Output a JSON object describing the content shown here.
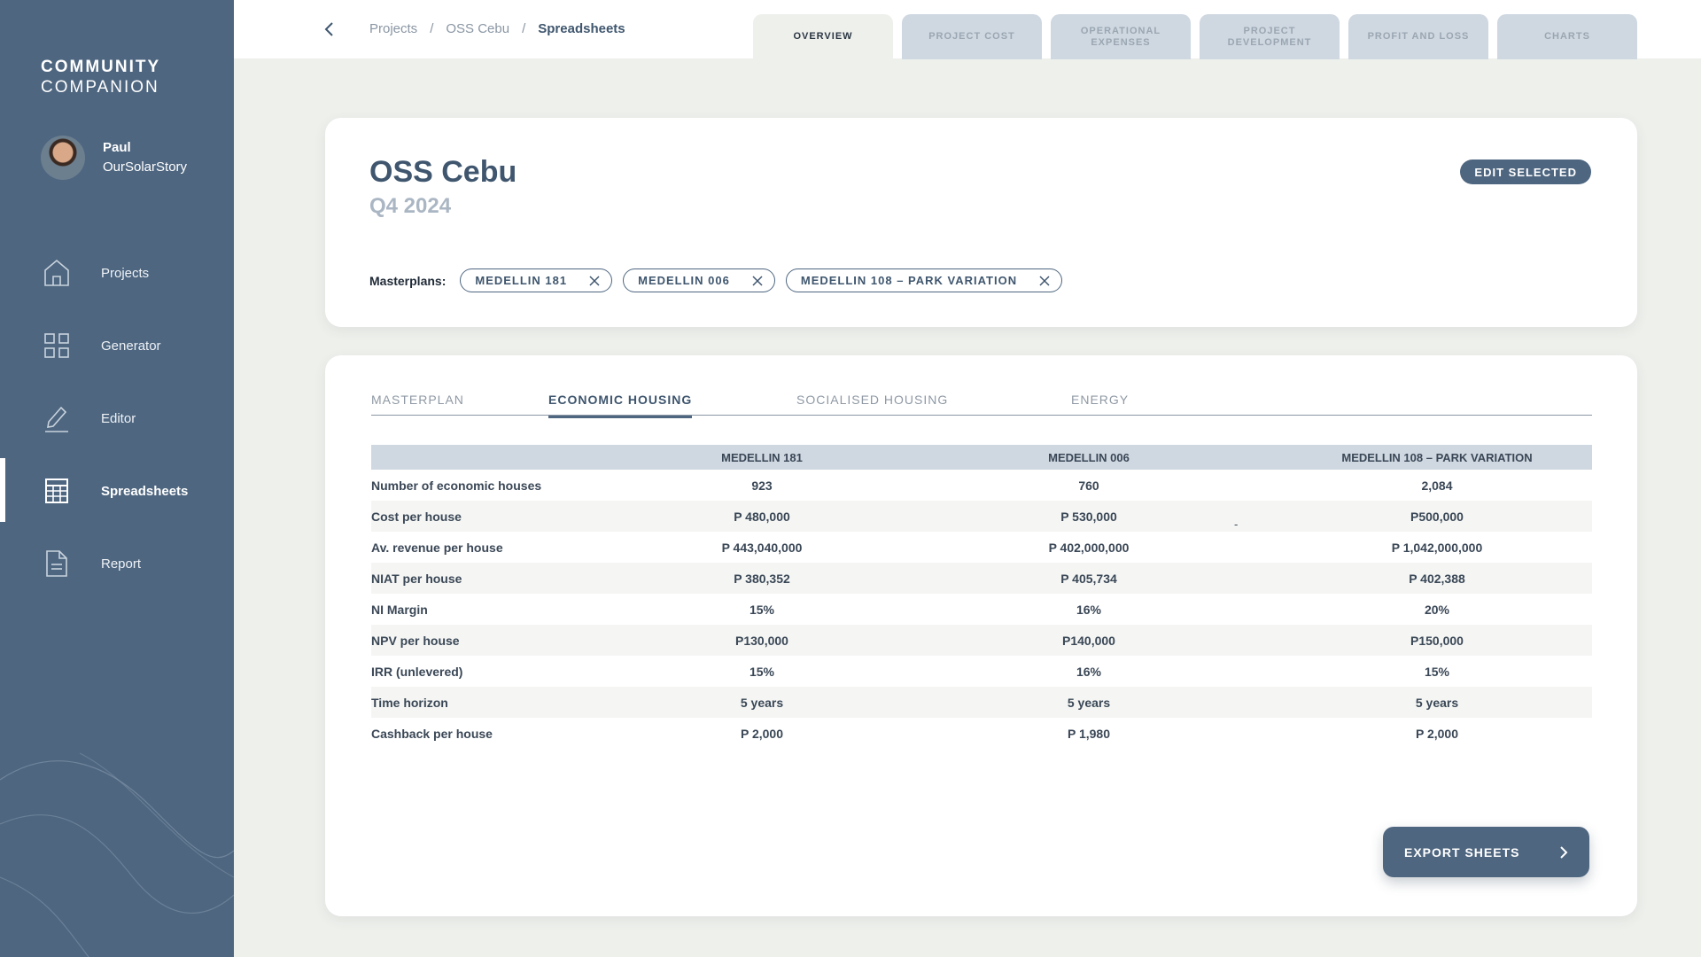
{
  "brand": {
    "line1": "COMMUNITY",
    "line2": "COMPANION"
  },
  "user": {
    "name": "Paul",
    "org": "OurSolarStory"
  },
  "sidebar": {
    "items": [
      {
        "label": "Projects",
        "icon": "home-icon"
      },
      {
        "label": "Generator",
        "icon": "grid-icon"
      },
      {
        "label": "Editor",
        "icon": "pencil-icon"
      },
      {
        "label": "Spreadsheets",
        "icon": "spreadsheet-icon",
        "active": true
      },
      {
        "label": "Report",
        "icon": "document-icon"
      }
    ]
  },
  "breadcrumb": [
    "Projects",
    "OSS Cebu",
    "Spreadsheets"
  ],
  "tabs": [
    {
      "label": "OVERVIEW",
      "active": true
    },
    {
      "label": "PROJECT COST"
    },
    {
      "label": "OPERATIONAL EXPENSES"
    },
    {
      "label": "PROJECT DEVELOPMENT"
    },
    {
      "label": "PROFIT AND LOSS"
    },
    {
      "label": "CHARTS"
    }
  ],
  "project": {
    "title": "OSS Cebu",
    "subtitle": "Q4 2024",
    "edit_label": "EDIT SELECTED",
    "masterplans_label": "Masterplans:",
    "masterplans": [
      "MEDELLIN 181",
      "MEDELLIN 006",
      "MEDELLIN 108 – PARK VARIATION"
    ]
  },
  "subtabs": [
    "MASTERPLAN",
    "ECONOMIC HOUSING",
    "SOCIALISED HOUSING",
    "ENERGY"
  ],
  "table": {
    "headers": [
      "",
      "MEDELLIN 181",
      "MEDELLIN 006",
      "MEDELLIN 108 – PARK VARIATION"
    ],
    "rows": [
      [
        "Number of economic houses",
        "923",
        "760",
        "2,084"
      ],
      [
        "Cost per house",
        "P 480,000",
        "P 530,000",
        "P500,000"
      ],
      [
        "Av. revenue per house",
        "P 443,040,000",
        "P 402,000,000",
        "P 1,042,000,000"
      ],
      [
        "NIAT per house",
        "P 380,352",
        "P 405,734",
        "P 402,388"
      ],
      [
        "NI Margin",
        "15%",
        "16%",
        "20%"
      ],
      [
        "NPV per house",
        "P130,000",
        "P140,000",
        "P150,000"
      ],
      [
        "IRR (unlevered)",
        "15%",
        "16%",
        "15%"
      ],
      [
        "Time horizon",
        "5 years",
        "5 years",
        "5 years"
      ],
      [
        "Cashback per house",
        "P 2,000",
        "P 1,980",
        "P 2,000"
      ]
    ],
    "stray_mark": "-"
  },
  "export_label": "EXPORT SHEETS",
  "colors": {
    "sidebar": "#4e6680",
    "accent": "#3f566e",
    "tab_inactive": "#cfd8e1",
    "background": "#eef0ec"
  }
}
